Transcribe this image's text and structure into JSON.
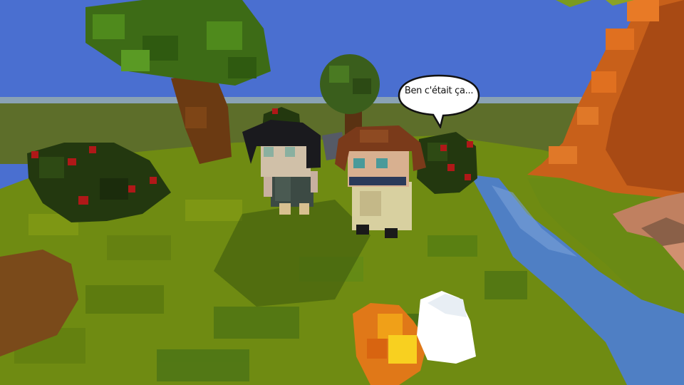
{
  "game": {
    "speech_bubble": {
      "text": "Ben c'était ça..."
    }
  },
  "colors": {
    "sky": "#4a6fd0",
    "horizon": "#8aa2b4",
    "grass": "#6f8b12",
    "grass_dark": "#3f5a10",
    "tree_leaves": "#3d6b16",
    "tree_trunk": "#6b3a12",
    "cliff": "#e07020",
    "river": "#4f7fc4",
    "fire": "#f0a018",
    "berry": "#b01818"
  }
}
